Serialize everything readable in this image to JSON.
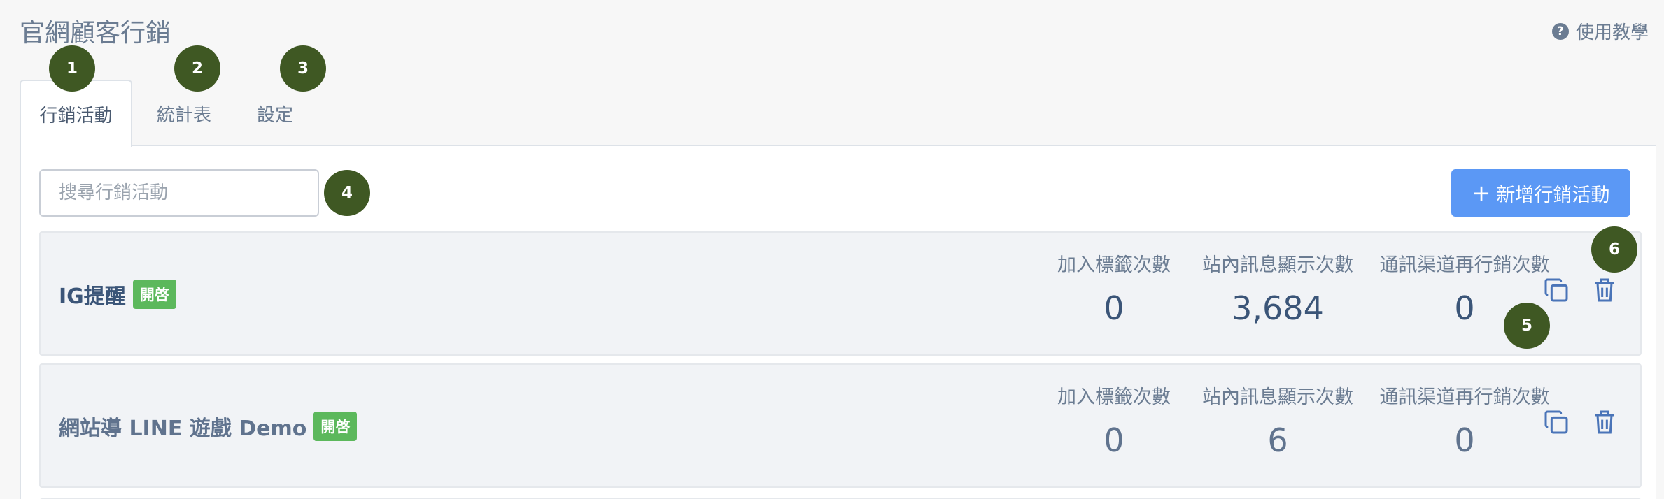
{
  "page": {
    "title": "官網顧客行銷",
    "help_label": "使用教學"
  },
  "tabs": [
    {
      "label": "行銷活動",
      "active": true
    },
    {
      "label": "統計表",
      "active": false
    },
    {
      "label": "設定",
      "active": false
    }
  ],
  "search": {
    "placeholder": "搜尋行銷活動",
    "value": ""
  },
  "toolbar": {
    "add_plus": "+",
    "add_label": "新增行銷活動"
  },
  "badges": [
    "1",
    "2",
    "3",
    "4",
    "5",
    "6"
  ],
  "campaigns": [
    {
      "name": "IG提醒",
      "status": "開啓",
      "stats": [
        {
          "label": "加入標籤次數",
          "value": "0"
        },
        {
          "label": "站內訊息顯示次數",
          "value": "3,684"
        },
        {
          "label": "通訊渠道再行銷次數",
          "value": "0"
        }
      ]
    },
    {
      "name": "網站導 LINE 遊戲 Demo",
      "status": "開啓",
      "stats": [
        {
          "label": "加入標籤次數",
          "value": "0"
        },
        {
          "label": "站內訊息顯示次數",
          "value": "6"
        },
        {
          "label": "通訊渠道再行銷次數",
          "value": "0"
        }
      ]
    }
  ],
  "icons": {
    "help": "question-circle-icon",
    "copy": "copy-icon",
    "delete": "trash-icon"
  },
  "colors": {
    "primary_button": "#5b98f5",
    "status_on": "#5cb85c",
    "annotation_badge": "#3f5823"
  }
}
